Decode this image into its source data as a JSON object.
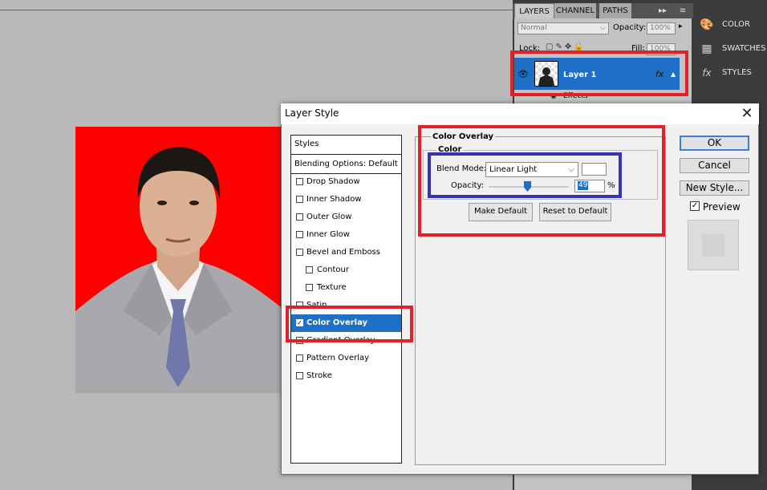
{
  "layers_panel": {
    "tabs": [
      "LAYERS",
      "CHANNEL",
      "PATHS"
    ],
    "blend_mode": "Normal",
    "opacity_label": "Opacity:",
    "opacity_value": "100%",
    "lock_label": "Lock:",
    "fill_label": "Fill:",
    "fill_value": "100%",
    "layer_name": "Layer 1",
    "fx_label": "fx",
    "effects_label": "Effects"
  },
  "side_panel": {
    "items": [
      {
        "label": "COLOR",
        "icon": "color-palette-icon"
      },
      {
        "label": "SWATCHES",
        "icon": "swatches-grid-icon"
      },
      {
        "label": "STYLES",
        "icon": "styles-fx-icon"
      }
    ]
  },
  "dialog": {
    "title": "Layer Style",
    "styles_header": "Styles",
    "blending_options": "Blending Options: Default",
    "styles": [
      {
        "label": "Drop Shadow",
        "checked": false,
        "indent": false
      },
      {
        "label": "Inner Shadow",
        "checked": false,
        "indent": false
      },
      {
        "label": "Outer Glow",
        "checked": false,
        "indent": false
      },
      {
        "label": "Inner Glow",
        "checked": false,
        "indent": false
      },
      {
        "label": "Bevel and Emboss",
        "checked": false,
        "indent": false
      },
      {
        "label": "Contour",
        "checked": false,
        "indent": true
      },
      {
        "label": "Texture",
        "checked": false,
        "indent": true
      },
      {
        "label": "Satin",
        "checked": false,
        "indent": false
      },
      {
        "label": "Color Overlay",
        "checked": true,
        "indent": false
      },
      {
        "label": "Gradient Overlay",
        "checked": false,
        "indent": false
      },
      {
        "label": "Pattern Overlay",
        "checked": false,
        "indent": false
      },
      {
        "label": "Stroke",
        "checked": false,
        "indent": false
      }
    ],
    "section_title": "Color Overlay",
    "group_title": "Color",
    "blend_mode_label": "Blend Mode:",
    "blend_mode_value": "Linear Light",
    "overlay_color": "#ffffff",
    "opacity_label": "Opacity:",
    "opacity_value": "49",
    "opacity_unit": "%",
    "make_default": "Make Default",
    "reset_default": "Reset to Default",
    "ok": "OK",
    "cancel": "Cancel",
    "new_style": "New Style...",
    "preview_label": "Preview",
    "preview_checked": true
  },
  "colors": {
    "photo_background": "#ff0000",
    "selection_blue": "#1e6fc8",
    "annotation_red": "#e0202a",
    "annotation_blue": "#3434b4"
  }
}
